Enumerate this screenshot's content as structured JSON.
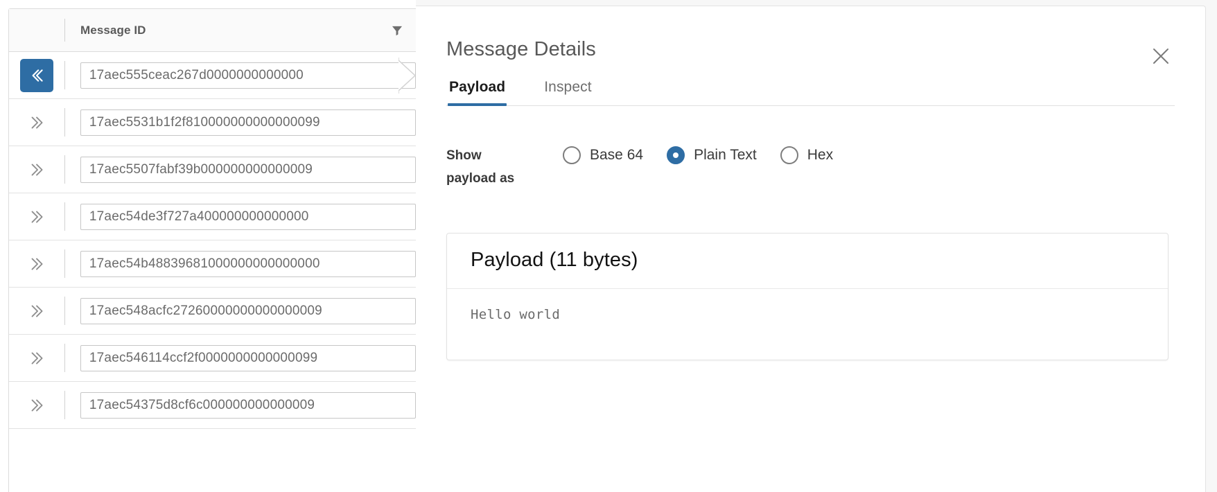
{
  "table": {
    "column_header": "Message ID",
    "filter_icon": "filter-icon",
    "collapse_icon": "chevron-double-left-icon",
    "expand_icon": "chevron-double-right-icon",
    "rows": [
      {
        "id": "17aec555ceac267d0000000000000",
        "selected": true
      },
      {
        "id": "17aec5531b1f2f810000000000000099",
        "selected": false
      },
      {
        "id": "17aec5507fabf39b000000000000009",
        "selected": false
      },
      {
        "id": "17aec54de3f727a400000000000000",
        "selected": false
      },
      {
        "id": "17aec54b48839681000000000000000",
        "selected": false
      },
      {
        "id": "17aec548acfc27260000000000000009",
        "selected": false
      },
      {
        "id": "17aec546114ccf2f0000000000000099",
        "selected": false
      },
      {
        "id": "17aec54375d8cf6c000000000000009",
        "selected": false
      }
    ]
  },
  "detail": {
    "title": "Message Details",
    "close_icon": "close-icon",
    "tabs": [
      {
        "label": "Payload",
        "active": true
      },
      {
        "label": "Inspect",
        "active": false
      }
    ],
    "mode": {
      "label": "Show payload as",
      "options": [
        {
          "label": "Base 64",
          "checked": false
        },
        {
          "label": "Plain Text",
          "checked": true
        },
        {
          "label": "Hex",
          "checked": false
        }
      ]
    },
    "payload": {
      "header": "Payload (11 bytes)",
      "content": "Hello world"
    }
  },
  "colors": {
    "accent": "#2e6da4",
    "panel_bg": "#f7f7f7",
    "border": "#dcdcdc",
    "text_muted": "#6b6b6b"
  }
}
